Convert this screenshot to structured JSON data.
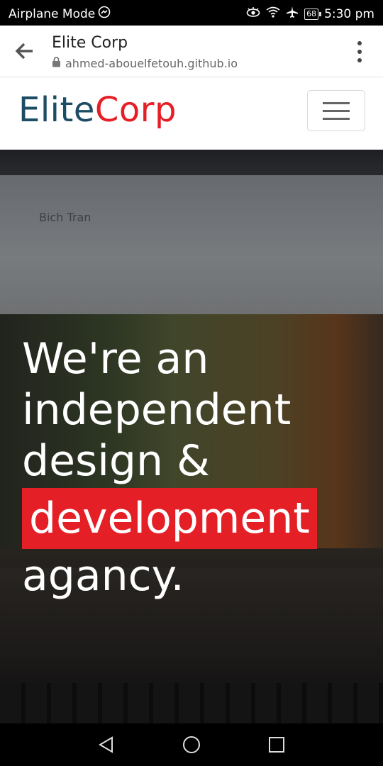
{
  "status": {
    "carrier": "Airplane Mode",
    "battery": "68",
    "time": "5:30 pm",
    "icons": [
      "messenger-icon",
      "eye-icon",
      "wifi-icon",
      "airplane-icon",
      "battery-icon"
    ]
  },
  "browser": {
    "title": "Elite Corp",
    "url": "ahmed-abouelfetouh.github.io"
  },
  "site": {
    "logo_part1": "Elite",
    "logo_part2": "Corp",
    "logo_colors": {
      "primary": "#1d4d65",
      "accent": "#e41f26"
    }
  },
  "hero": {
    "background_profile_name": "Bich Tran",
    "line1": "We're an",
    "line2": "independent",
    "line3": "design &",
    "highlight": "development",
    "line5": "agancy.",
    "highlight_color": "#e41f26"
  },
  "nav": {
    "icons": [
      "back-triangle-icon",
      "home-circle-icon",
      "recents-square-icon"
    ]
  }
}
